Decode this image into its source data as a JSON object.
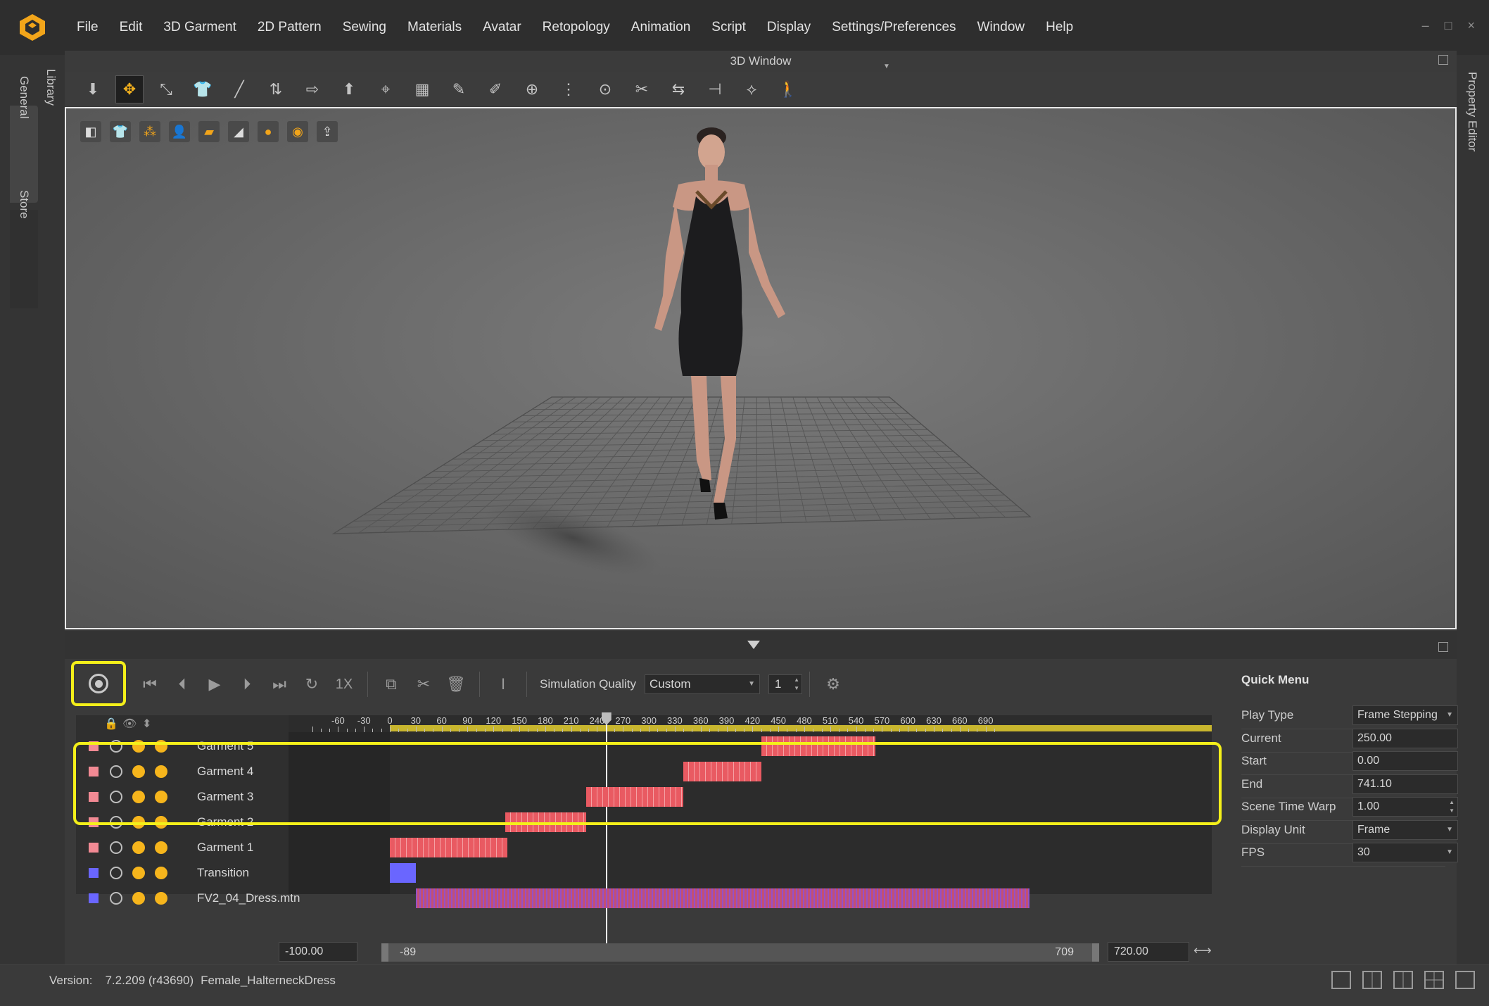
{
  "menubar": {
    "items": [
      "File",
      "Edit",
      "3D Garment",
      "2D Pattern",
      "Sewing",
      "Materials",
      "Avatar",
      "Retopology",
      "Animation",
      "Script",
      "Display",
      "Settings/Preferences",
      "Window",
      "Help"
    ],
    "window_controls": [
      "–",
      "□",
      "×"
    ]
  },
  "left_rail": {
    "tabs": [
      "General",
      "Library",
      "Store"
    ]
  },
  "right_rail": {
    "tab": "Property Editor"
  },
  "window3d": {
    "title": "3D Window"
  },
  "toolbar": {
    "icons": [
      "move-down-icon",
      "select-move-icon",
      "transform-icon",
      "garment-icon",
      "pin-icon",
      "fold-icon",
      "arrange-icon",
      "avatar-pose-icon",
      "tack-icon",
      "grid-icon",
      "sewing-icon",
      "measure-icon",
      "point-icon",
      "zip-icon",
      "button-icon",
      "trim-icon",
      "flip-icon",
      "align-icon",
      "tool-icon",
      "walk-icon"
    ]
  },
  "viewport": {
    "icons": [
      "garment-view-icon",
      "shirt-icon",
      "points-icon",
      "avatar-icon",
      "texture-icon",
      "shadow-icon",
      "head-icon",
      "globe-icon",
      "export-icon"
    ]
  },
  "animation_toolbar": {
    "speed_label": "1X",
    "sim_quality_label": "Simulation Quality",
    "sim_quality_value": "Custom",
    "step_value": "1"
  },
  "tracks": [
    {
      "name": "Garment 5",
      "color": "#f28a94"
    },
    {
      "name": "Garment 4",
      "color": "#f28a94"
    },
    {
      "name": "Garment 3",
      "color": "#f28a94"
    },
    {
      "name": "Garment 2",
      "color": "#f28a94"
    },
    {
      "name": "Garment 1",
      "color": "#f28a94"
    },
    {
      "name": "Transition",
      "color": "#6a66ff"
    },
    {
      "name": "FV2_04_Dress.mtn",
      "color": "#6a66ff"
    }
  ],
  "timeline": {
    "tick_labels": [
      "-60",
      "-30",
      "0",
      "30",
      "60",
      "90",
      "120",
      "150",
      "180",
      "210",
      "240",
      "270",
      "300",
      "330",
      "360",
      "390",
      "420",
      "450",
      "480",
      "510",
      "540",
      "570",
      "600",
      "630",
      "660",
      "690"
    ],
    "playhead_frame": 250,
    "clips": [
      {
        "track": 0,
        "start": 430,
        "end": 562
      },
      {
        "track": 1,
        "start": 340,
        "end": 430
      },
      {
        "track": 2,
        "start": 227,
        "end": 340
      },
      {
        "track": 3,
        "start": 134,
        "end": 227
      },
      {
        "track": 4,
        "start": 0,
        "end": 136
      },
      {
        "track": 5,
        "start": 0,
        "end": 30
      },
      {
        "track": 6,
        "start": 30,
        "end": 741
      }
    ],
    "range_start_field": "-100.00",
    "range_left_label": "-89",
    "range_right_label": "709",
    "range_end_field": "720.00"
  },
  "quick_menu": {
    "title": "Quick Menu",
    "rows": [
      {
        "label": "Play Type",
        "value": "Frame Stepping"
      },
      {
        "label": "Current",
        "value": "250.00"
      },
      {
        "label": "Start",
        "value": "0.00"
      },
      {
        "label": "End",
        "value": "741.10"
      },
      {
        "label": "Scene Time Warp",
        "value": "1.00"
      },
      {
        "label": "Display Unit",
        "value": "Frame"
      },
      {
        "label": "FPS",
        "value": "30"
      }
    ]
  },
  "status": {
    "version_label": "Version:",
    "version_value": "7.2.209 (r43690)",
    "file_name": "Female_HalterneckDress"
  },
  "colors": {
    "highlight": "#f4ef1a",
    "accent": "#f6b51c",
    "clip": "#e95a62",
    "transition": "#6a66ff"
  }
}
